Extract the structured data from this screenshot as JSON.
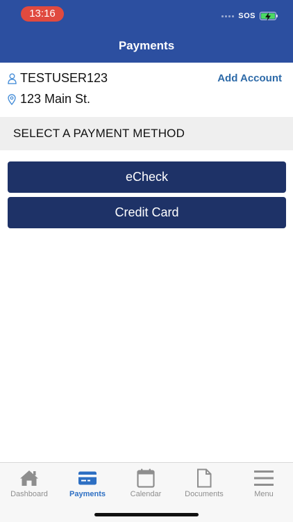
{
  "status_bar": {
    "time": "13:16",
    "carrier_text": "SOS",
    "battery_icon": "battery-charging-icon"
  },
  "header": {
    "title": "Payments"
  },
  "account": {
    "username": "TESTUSER123",
    "address": "123 Main St.",
    "add_account_label": "Add Account",
    "user_icon": "user-icon",
    "location_icon": "location-pin-icon"
  },
  "section": {
    "title": "SELECT A PAYMENT METHOD"
  },
  "payment_methods": [
    {
      "label": "eCheck"
    },
    {
      "label": "Credit Card"
    }
  ],
  "tabbar": {
    "active": "Payments",
    "tabs": [
      {
        "label": "Dashboard",
        "icon": "home-icon"
      },
      {
        "label": "Payments",
        "icon": "credit-card-icon"
      },
      {
        "label": "Calendar",
        "icon": "calendar-icon"
      },
      {
        "label": "Documents",
        "icon": "document-icon"
      },
      {
        "label": "Menu",
        "icon": "hamburger-menu-icon"
      }
    ]
  },
  "colors": {
    "header_bg": "#2c4fa0",
    "button_bg": "#1e3267",
    "link": "#2d6aa8",
    "tab_active": "#2d6fc3",
    "tab_inactive": "#8e8e8e",
    "time_pill": "#e04a3f"
  }
}
